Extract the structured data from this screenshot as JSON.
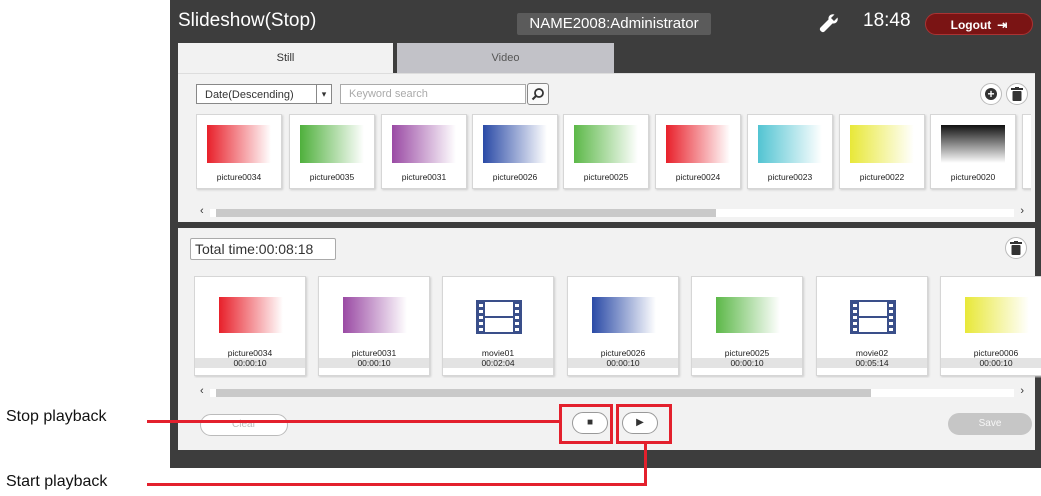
{
  "header": {
    "title": "Slideshow(Stop)",
    "user": "NAME2008:Administrator",
    "time": "18:48",
    "logout_label": "Logout"
  },
  "tabs": [
    {
      "label": "Still",
      "active": true
    },
    {
      "label": "Video",
      "active": false
    }
  ],
  "library": {
    "sort_value": "Date(Descending)",
    "search_placeholder": "Keyword search",
    "items": [
      {
        "label": "picture0034",
        "color": "#e8202a"
      },
      {
        "label": "picture0035",
        "color": "#4fb03c"
      },
      {
        "label": "picture0031",
        "color": "#9a4aa4"
      },
      {
        "label": "picture0026",
        "color": "#2a4aa6"
      },
      {
        "label": "picture0025",
        "color": "#5cb848"
      },
      {
        "label": "picture0024",
        "color": "#e8202a"
      },
      {
        "label": "picture0023",
        "color": "#52c4d2"
      },
      {
        "label": "picture0022",
        "color": "#e8e838"
      },
      {
        "label": "picture0020",
        "color": "#111111"
      }
    ]
  },
  "playlist": {
    "total_time": "Total time:00:08:18",
    "items": [
      {
        "label": "picture0034",
        "duration": "00:00:10",
        "type": "image",
        "color": "#e8202a"
      },
      {
        "label": "picture0031",
        "duration": "00:00:10",
        "type": "image",
        "color": "#9a4aa4"
      },
      {
        "label": "movie01",
        "duration": "00:02:04",
        "type": "movie",
        "color": "#3a4f8a"
      },
      {
        "label": "picture0026",
        "duration": "00:00:10",
        "type": "image",
        "color": "#2a4aa6"
      },
      {
        "label": "picture0025",
        "duration": "00:00:10",
        "type": "image",
        "color": "#5cb848"
      },
      {
        "label": "movie02",
        "duration": "00:05:14",
        "type": "movie",
        "color": "#3a4f8a"
      },
      {
        "label": "picture0006",
        "duration": "00:00:10",
        "type": "image",
        "color": "#e8e838"
      }
    ],
    "clear_label": "Clear",
    "save_label": "Save"
  },
  "annotations": {
    "stop": "Stop playback",
    "start": "Start playback",
    "color": "#e3202d"
  }
}
